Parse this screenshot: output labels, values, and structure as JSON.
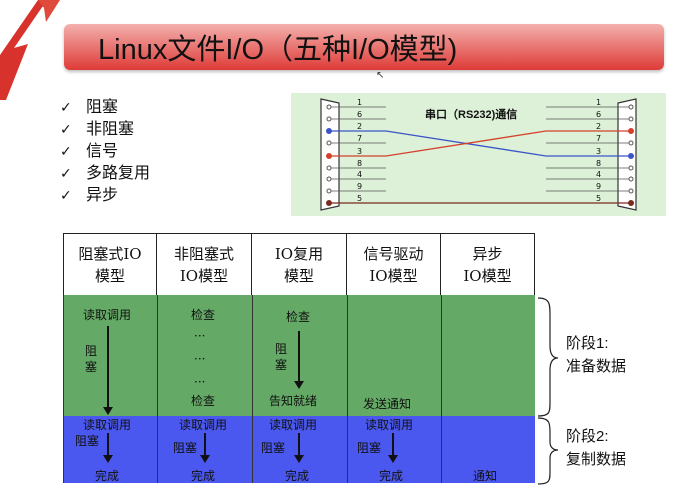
{
  "title": "Linux文件I/O（五种I/O模型)",
  "bullets": [
    {
      "check": "✓",
      "label": "阻塞"
    },
    {
      "check": "✓",
      "label": "非阻塞"
    },
    {
      "check": "✓",
      "label": "信号"
    },
    {
      "check": "✓",
      "label": "多路复用"
    },
    {
      "check": "✓",
      "label": "异步"
    }
  ],
  "serial": {
    "label": "串口（RS232)通信",
    "left_pins": [
      "1",
      "6",
      "2",
      "7",
      "3",
      "8",
      "4",
      "9",
      "5"
    ],
    "right_pins": [
      "1",
      "6",
      "2",
      "7",
      "3",
      "8",
      "4",
      "9",
      "5"
    ],
    "colors": {
      "tx": "#3a55c8",
      "rx": "#d4412b",
      "gnd": "#7a2b1d",
      "panel": "#ddf0d8"
    }
  },
  "table": {
    "headers": [
      [
        "阻塞式IO",
        "模型"
      ],
      [
        "非阻塞式",
        "IO模型"
      ],
      [
        "IO复用",
        "模型"
      ],
      [
        "信号驱动",
        "IO模型"
      ],
      [
        "异步",
        "IO模型"
      ]
    ],
    "col1": {
      "stage1_read": "读取调用",
      "block": "阻塞",
      "stage2_read": "读取调用",
      "stage2_block": "阻塞",
      "done": "完成"
    },
    "col2": {
      "check1": "检查",
      "dots1": "···",
      "dots2": "···",
      "dots3": "···",
      "check2": "检查",
      "read": "读取调用",
      "block": "阻塞",
      "done": "完成"
    },
    "col3": {
      "check": "检查",
      "block": "阻塞",
      "ready": "告知就绪",
      "read": "读取调用",
      "block2": "阻塞",
      "done": "完成"
    },
    "col4": {
      "notify": "发送通知",
      "read": "读取调用",
      "block": "阻塞",
      "done": "完成"
    },
    "col5": {
      "notify": "通知"
    },
    "colors": {
      "stage1": "#64a965",
      "stage2": "#4a58ef"
    }
  },
  "stages": [
    {
      "line1": "阶段1:",
      "line2": "准备数据"
    },
    {
      "line1": "阶段2:",
      "line2": "复制数据"
    }
  ]
}
